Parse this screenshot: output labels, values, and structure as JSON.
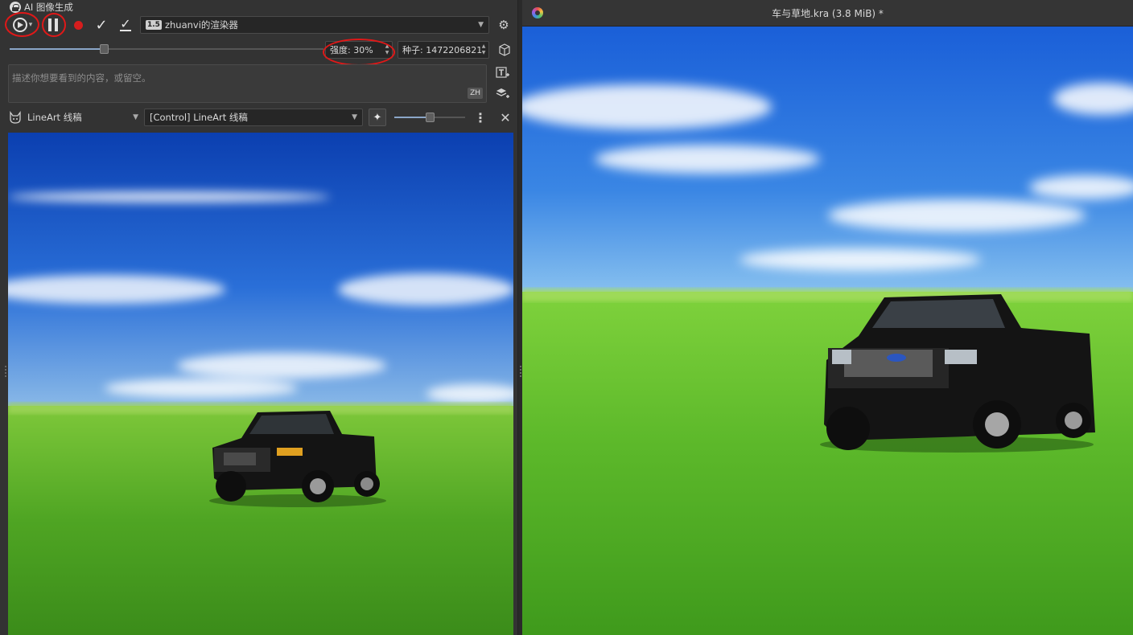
{
  "docker": {
    "title": "AI 图像生成",
    "workspace": {
      "version_badge": "1.5",
      "name": "zhuanvi的渲染器"
    },
    "strength_label": "强度: 30%",
    "strength_value": 0.3,
    "seed_label": "种子: 1472206821",
    "prompt_placeholder": "描述你想要看到的内容，或留空。",
    "language_badge": "ZH",
    "control": {
      "type": "LineArt 线稿",
      "layer": "[Control] LineArt 线稿",
      "strength_value": 0.5
    }
  },
  "icons": {
    "generate": "play-icon",
    "pause": "pause-icon",
    "record": "record-icon",
    "apply": "check-icon",
    "apply_layer": "check-underline-icon",
    "settings": "gear-icon",
    "seed": "dice-cube-icon",
    "add_text": "text-add-icon",
    "add_layer": "layer-add-icon",
    "control_type": "cat-icon",
    "sparkle": "sparkle-icon",
    "more": "more-vertical-icon",
    "close": "close-icon",
    "app": "krita-icon"
  },
  "canvas": {
    "title": "车与草地.kra (3.8 MiB) *"
  },
  "colors": {
    "highlight_circle": "#e01818",
    "record": "#d61d1d",
    "panel_bg": "#333333"
  }
}
